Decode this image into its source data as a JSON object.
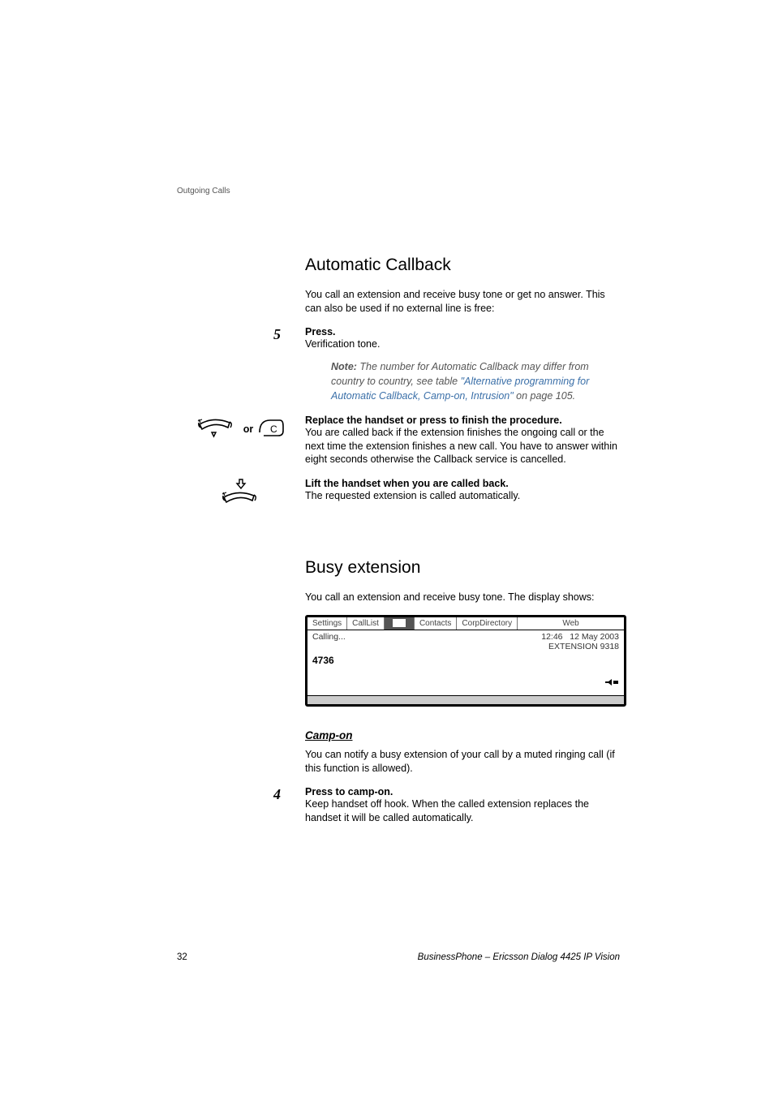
{
  "header": {
    "section": "Outgoing Calls"
  },
  "sec1": {
    "title": "Automatic Callback",
    "intro": "You call an extension and receive busy tone or get no answer. This can also be used if no external line is free:",
    "step5": {
      "num": "5",
      "label": "Press.",
      "desc": "Verification tone."
    },
    "note": {
      "prefix": "Note:",
      "body1": " The number for Automatic Callback may differ from country to country, see table ",
      "link": "\"Alternative programming for Automatic Callback, Camp-on, Intrusion\"",
      "body2": " on page 105."
    },
    "or_label": "or",
    "c_label": "C",
    "replace": {
      "label": "Replace the handset or press to finish the procedure.",
      "desc": "You are called back if the extension finishes the ongoing call or the next time the extension finishes a new call. You have to answer within eight seconds otherwise the Callback service is cancelled."
    },
    "lift": {
      "label": "Lift the handset when you are called back.",
      "desc": "The requested extension is called automatically."
    }
  },
  "sec2": {
    "title": "Busy extension",
    "intro": "You call an extension and receive busy tone. The display shows:",
    "display": {
      "tabs": {
        "settings": "Settings",
        "calllist": "CallList",
        "contacts": "Contacts",
        "corpdir": "CorpDirectory",
        "web": "Web"
      },
      "calling": "Calling...",
      "time": "12:46",
      "date": "12 May 2003",
      "ext_label": "EXTENSION 9318",
      "number": "4736"
    },
    "campon": {
      "heading": "Camp-on",
      "desc": "You can notify a busy extension of your call by a muted ringing call (if this function is allowed)."
    },
    "step4": {
      "num": "4",
      "label": "Press to camp-on.",
      "desc": "Keep handset off hook. When the called extension replaces the handset it will be called automatically."
    }
  },
  "footer": {
    "page": "32",
    "title": "BusinessPhone – Ericsson Dialog 4425 IP Vision"
  }
}
